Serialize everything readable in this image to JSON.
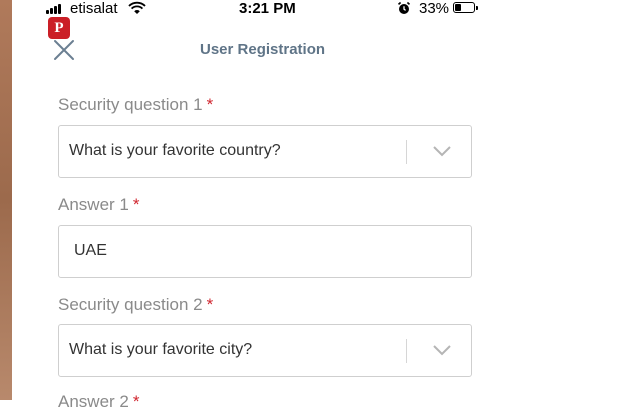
{
  "status_bar": {
    "carrier": "etisalat",
    "time": "3:21 PM",
    "battery": "33%",
    "battery_level": 0.33,
    "icons": [
      "signal-icon",
      "wifi-icon",
      "alarm-icon",
      "battery-icon"
    ]
  },
  "badge": {
    "label": "P",
    "icon": "pinterest-icon",
    "color": "#cb1f27"
  },
  "header": {
    "title": "User Registration",
    "close_icon": "close-icon"
  },
  "form": {
    "required_mark": "*",
    "security_question_1": {
      "label": "Security question 1",
      "value": "What is your favorite country?"
    },
    "answer_1": {
      "label": "Answer 1",
      "value": "UAE"
    },
    "security_question_2": {
      "label": "Security question 2",
      "value": "What is your favorite city?"
    },
    "answer_2": {
      "label": "Answer 2"
    }
  },
  "colors": {
    "header_title": "#5f7487",
    "required": "#d0262f",
    "label": "#8a8a8a"
  }
}
